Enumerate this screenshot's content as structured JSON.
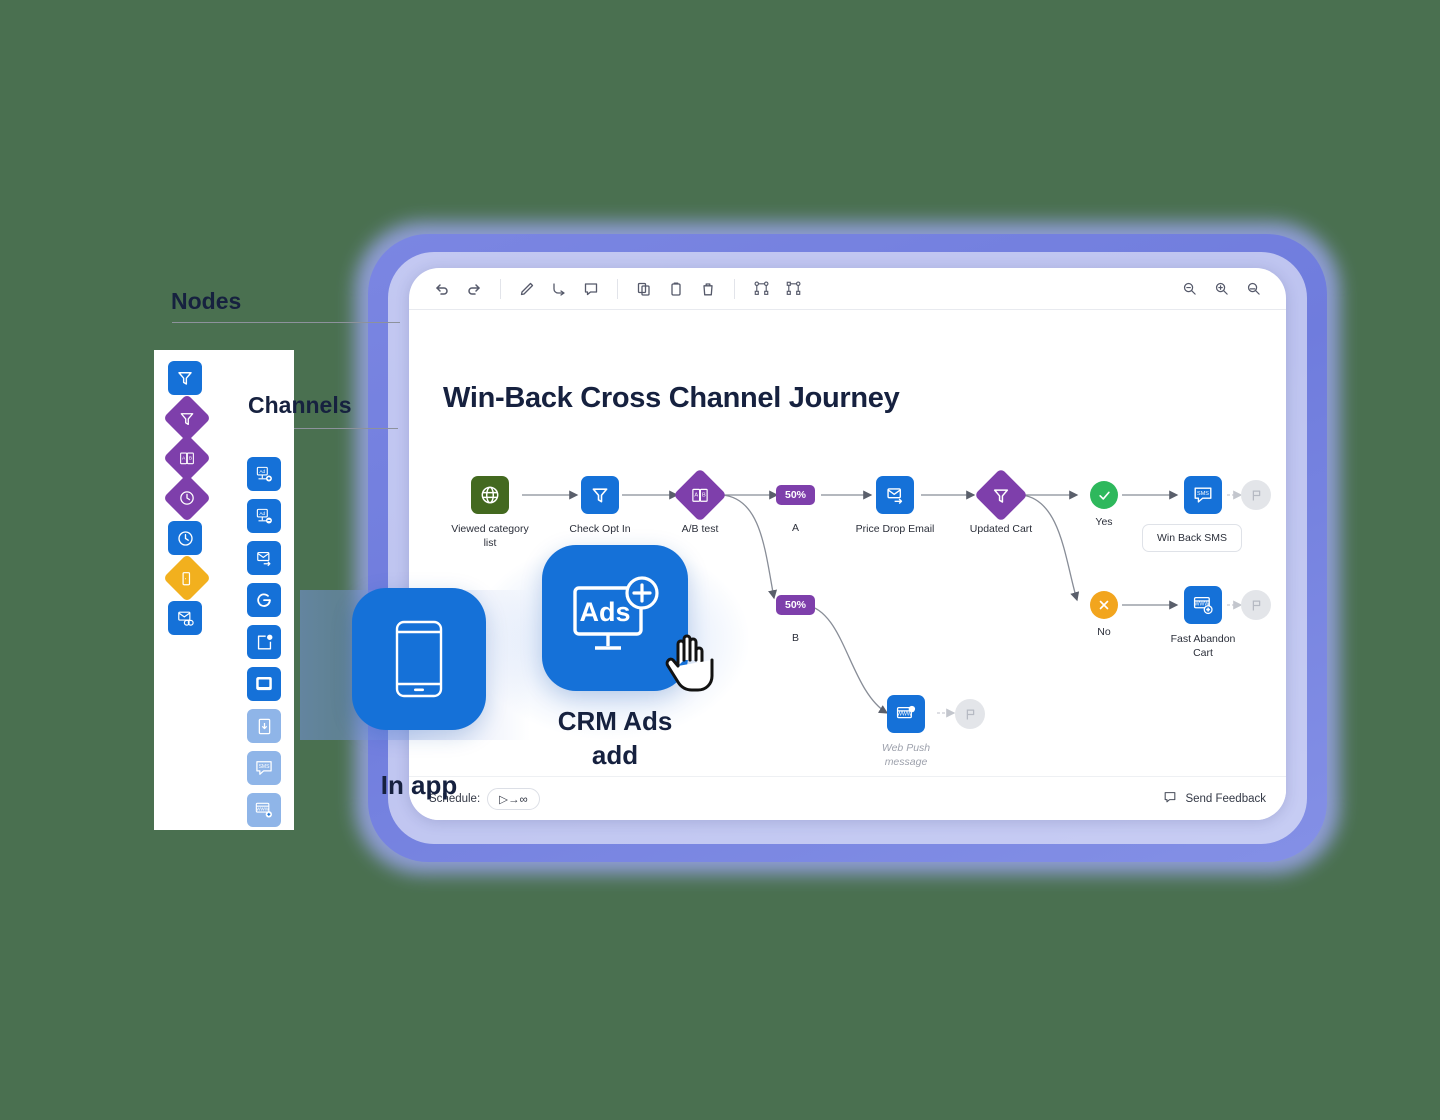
{
  "app": {
    "journey_title": "Win-Back Cross Channel Journey"
  },
  "toolbar": {
    "items": [
      {
        "name": "undo",
        "label": "Undo"
      },
      {
        "name": "redo",
        "label": "Redo"
      },
      {
        "name": "pencil",
        "label": "Draw"
      },
      {
        "name": "connector",
        "label": "Connector"
      },
      {
        "name": "comment",
        "label": "Comment"
      },
      {
        "name": "copy",
        "label": "Copy"
      },
      {
        "name": "paste",
        "label": "Paste"
      },
      {
        "name": "delete",
        "label": "Delete"
      },
      {
        "name": "auto-layout",
        "label": "Auto layout"
      },
      {
        "name": "align-nodes",
        "label": "Align nodes"
      },
      {
        "name": "zoom-out",
        "label": "Zoom out"
      },
      {
        "name": "zoom-in",
        "label": "Zoom in"
      },
      {
        "name": "zoom-reset",
        "label": "Reset zoom"
      }
    ]
  },
  "flow": {
    "nodes": [
      {
        "id": "viewed",
        "label": "Viewed category\nlist",
        "shape": "square",
        "color": "#43691f",
        "icon": "globe-icon"
      },
      {
        "id": "optin",
        "label": "Check Opt In",
        "shape": "square",
        "color": "#1571d8",
        "icon": "filter-icon"
      },
      {
        "id": "abtest",
        "label": "A/B test",
        "shape": "diamond",
        "color": "#7e3fab",
        "icon": "ab-test-icon"
      },
      {
        "id": "branch_a",
        "label": "A",
        "shape": "badge",
        "color": "#7e3fab",
        "badge": "50%"
      },
      {
        "id": "pricedrop",
        "label": "Price Drop Email",
        "shape": "square",
        "color": "#1571d8",
        "icon": "email-send-icon"
      },
      {
        "id": "updatedcart",
        "label": "Updated Cart",
        "shape": "diamond",
        "color": "#7e3fab",
        "icon": "filter-icon"
      },
      {
        "id": "yes",
        "label": "Yes",
        "shape": "circle",
        "color": "#2eb85c",
        "icon": "check-icon"
      },
      {
        "id": "no",
        "label": "No",
        "shape": "circle",
        "color": "#f2a51e",
        "icon": "close-icon"
      },
      {
        "id": "winbacksms",
        "label": "Win Back SMS",
        "shape": "square",
        "color": "#1571d8",
        "icon": "sms-icon"
      },
      {
        "id": "fastcart",
        "label": "Fast Abandon\nCart",
        "shape": "square",
        "color": "#1571d8",
        "icon": "web-push-add-icon"
      },
      {
        "id": "branch_b",
        "label": "B",
        "shape": "badge",
        "color": "#7e3fab",
        "badge": "50%"
      },
      {
        "id": "webpush",
        "label": "Web Push\nmessage",
        "shape": "square",
        "color": "#1571d8",
        "icon": "web-push-icon"
      }
    ],
    "labels": {
      "viewed_line1": "Viewed category",
      "viewed_line2": "list",
      "optin": "Check Opt In",
      "abtest": "A/B test",
      "branch_a": "A",
      "branch_b": "B",
      "pct_a": "50%",
      "pct_b": "50%",
      "pricedrop": "Price Drop Email",
      "updatedcart": "Updated Cart",
      "yes": "Yes",
      "no": "No",
      "winback_chip": "Win Back SMS",
      "fastcart_line1": "Fast Abandon",
      "fastcart_line2": "Cart",
      "webpush_line1": "Web Push",
      "webpush_line2": "message"
    }
  },
  "bottom_bar": {
    "schedule_label": "Schedule:",
    "schedule_value": "▷→∞",
    "feedback_label": "Send Feedback"
  },
  "palette": {
    "nodes_heading": "Nodes",
    "channels_heading": "Channels",
    "node_items": [
      {
        "name": "filter-square-icon",
        "shape": "square",
        "color": "#1571d8"
      },
      {
        "name": "filter-diamond-icon",
        "shape": "diamond",
        "color": "#7e3fab"
      },
      {
        "name": "ab-test-icon",
        "shape": "diamond",
        "color": "#7e3fab"
      },
      {
        "name": "clock-diamond-icon",
        "shape": "diamond",
        "color": "#7e3fab"
      },
      {
        "name": "clock-square-icon",
        "shape": "square",
        "color": "#1571d8"
      },
      {
        "name": "exit-diamond-icon",
        "shape": "diamond",
        "color": "#f2b01e"
      },
      {
        "name": "email-loop-icon",
        "shape": "square",
        "color": "#1571d8"
      }
    ],
    "channel_items": [
      {
        "name": "ad-add-icon",
        "state": "active"
      },
      {
        "name": "ad-remove-icon",
        "state": "active"
      },
      {
        "name": "email-send-icon",
        "state": "active"
      },
      {
        "name": "google-icon",
        "state": "active"
      },
      {
        "name": "app-push-icon",
        "state": "active"
      },
      {
        "name": "in-app-icon",
        "state": "active"
      },
      {
        "name": "download-icon",
        "state": "faded"
      },
      {
        "name": "sms-icon",
        "state": "faded"
      },
      {
        "name": "web-push-icon",
        "state": "faded"
      }
    ]
  },
  "features": {
    "inapp_caption": "In app",
    "ads_caption_line1": "CRM Ads",
    "ads_caption_line2": "add",
    "ads_icon_text": "Ads"
  },
  "colors": {
    "background": "#4a7050",
    "bezel": "#7b86e2",
    "brand_blue": "#1571d8",
    "purple": "#7e3fab",
    "green": "#43691f",
    "success": "#2eb85c",
    "warning": "#f2a51e",
    "title_navy": "#16213f"
  }
}
